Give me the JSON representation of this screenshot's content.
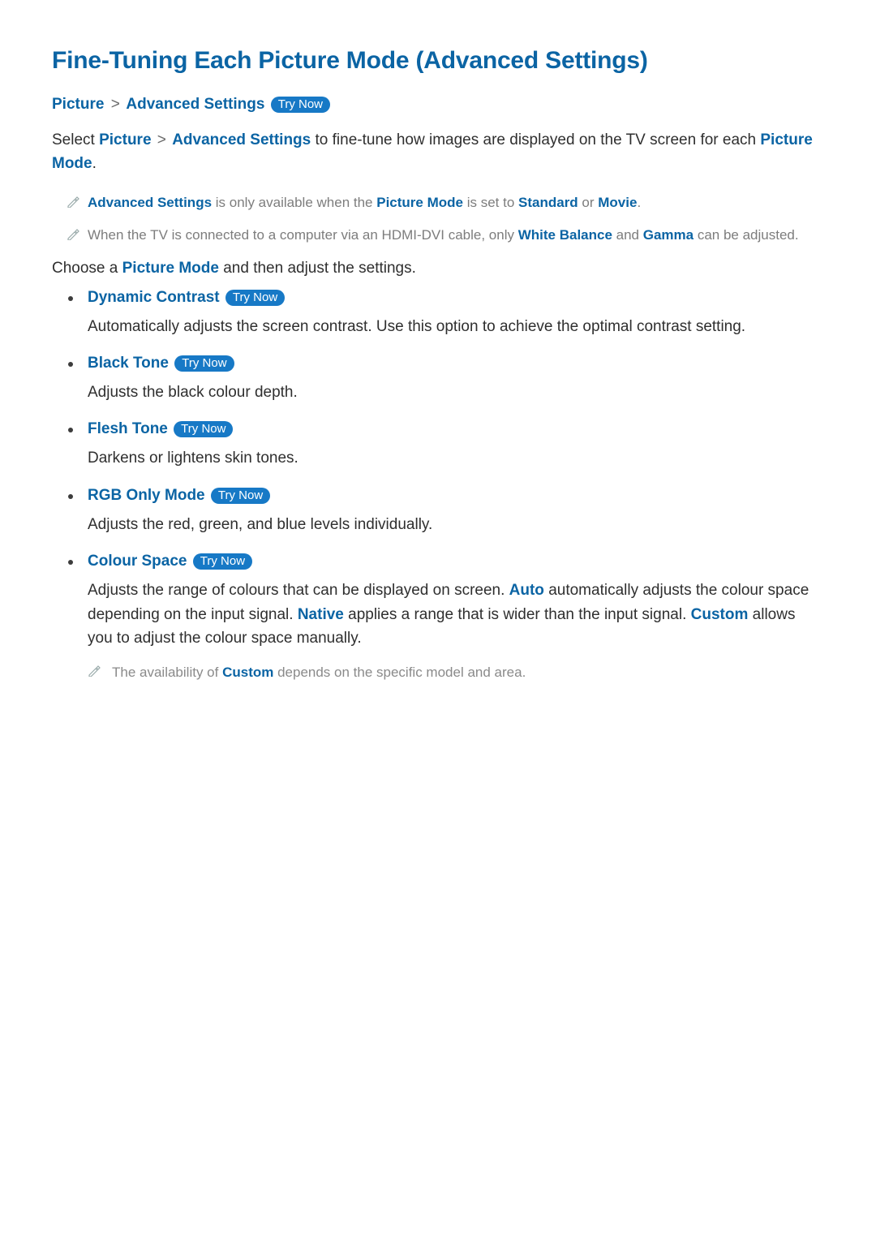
{
  "header": {
    "title": "Fine-Tuning Each Picture Mode (Advanced Settings)"
  },
  "breadcrumb": {
    "part1": "Picture",
    "sep": ">",
    "part2": "Advanced Settings",
    "tryNow": "Try Now"
  },
  "intro": {
    "pre": "Select ",
    "kw1": "Picture",
    "sep": ">",
    "kw2": "Advanced Settings",
    "mid": " to fine-tune how images are displayed on the TV screen for each ",
    "kw3": "Picture Mode",
    "post": "."
  },
  "notes": [
    {
      "kw1": "Advanced Settings",
      "t1": " is only available when the ",
      "kw2": "Picture Mode",
      "t2": " is set to ",
      "kw3": "Standard",
      "t3": " or ",
      "kw4": "Movie",
      "t4": "."
    },
    {
      "t1": "When the TV is connected to a computer via an HDMI-DVI cable, only ",
      "kw1": "White Balance",
      "t2": " and ",
      "kw2": "Gamma",
      "t3": " can be adjusted."
    }
  ],
  "lead": {
    "t1": "Choose a ",
    "kw1": "Picture Mode",
    "t2": " and then adjust the settings."
  },
  "settings": [
    {
      "title": "Dynamic Contrast",
      "tryNow": "Try Now",
      "desc": "Automatically adjusts the screen contrast. Use this option to achieve the optimal contrast setting."
    },
    {
      "title": "Black Tone",
      "tryNow": "Try Now",
      "desc": "Adjusts the black colour depth."
    },
    {
      "title": "Flesh Tone",
      "tryNow": "Try Now",
      "desc": "Darkens or lightens skin tones."
    },
    {
      "title": "RGB Only Mode",
      "tryNow": "Try Now",
      "desc": "Adjusts the red, green, and blue levels individually."
    },
    {
      "title": "Colour Space",
      "tryNow": "Try Now",
      "desc_parts": {
        "t1": "Adjusts the range of colours that can be displayed on screen. ",
        "kw1": "Auto",
        "t2": " automatically adjusts the colour space depending on the input signal. ",
        "kw2": "Native",
        "t3": " applies a range that is wider than the input signal. ",
        "kw3": "Custom",
        "t4": " allows you to adjust the colour space manually."
      },
      "subnote": {
        "t1": "The availability of ",
        "kw1": "Custom",
        "t2": " depends on the specific model and area."
      }
    }
  ]
}
